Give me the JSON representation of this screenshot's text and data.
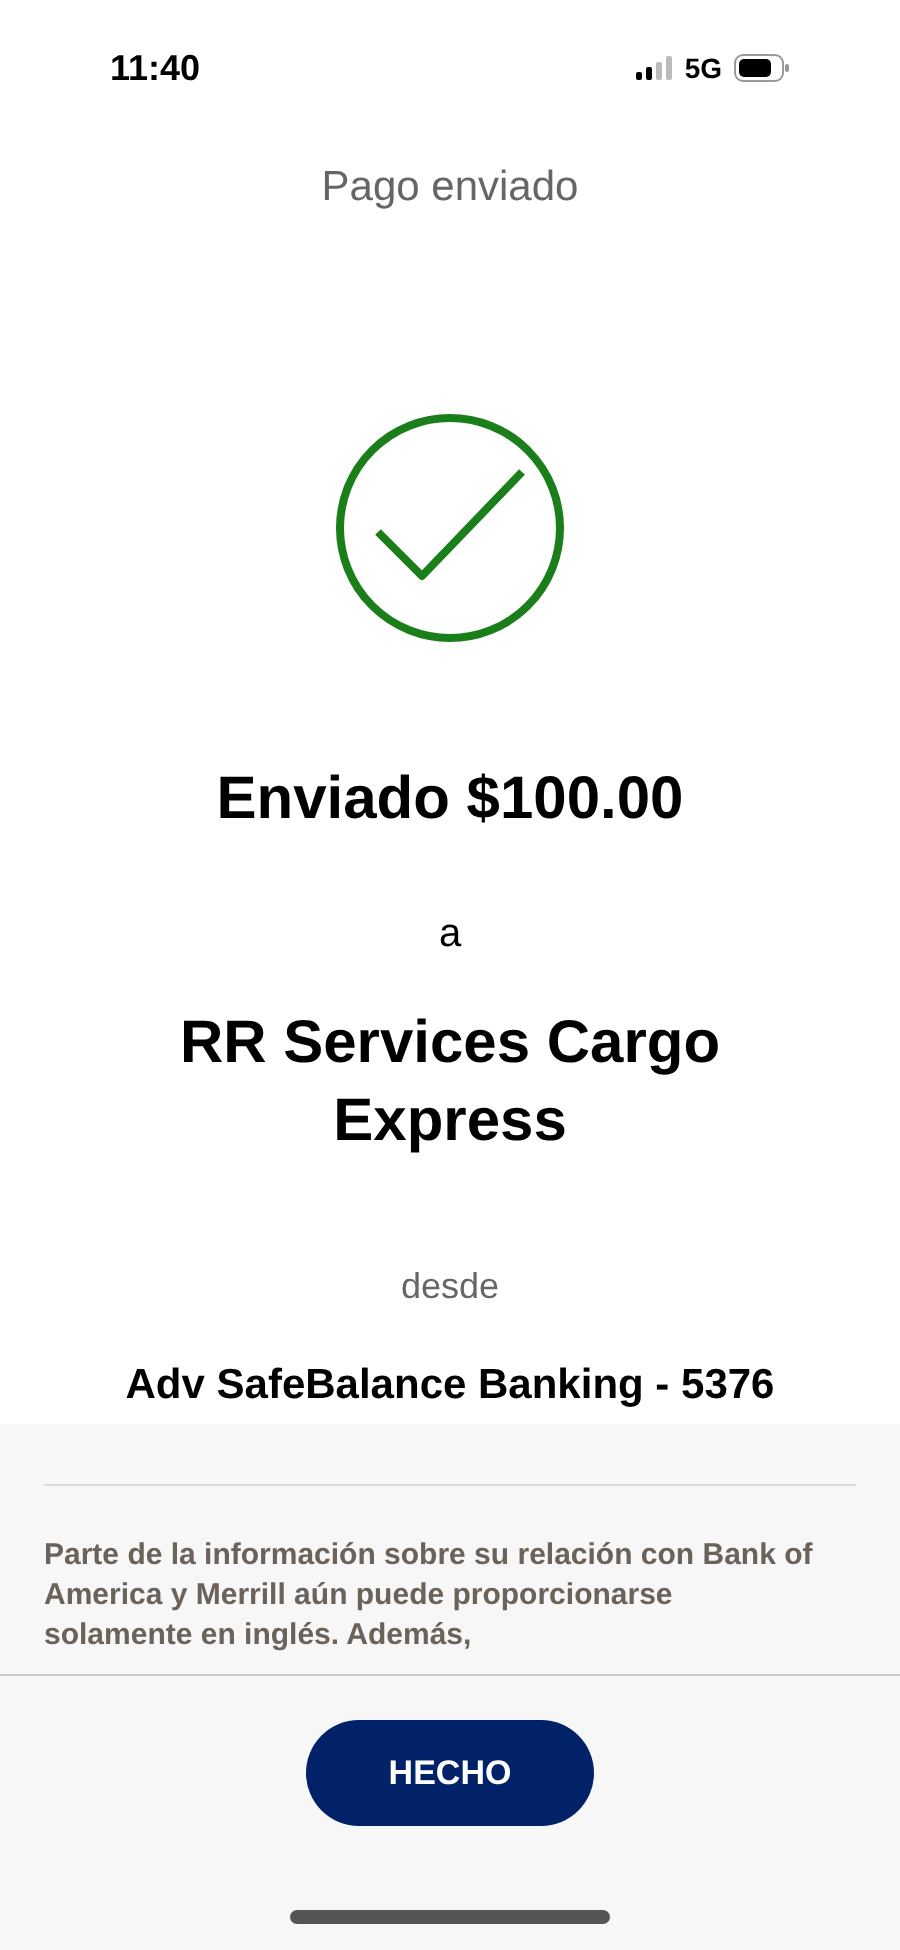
{
  "status_bar": {
    "time": "11:40",
    "network": "5G"
  },
  "title": "Pago enviado",
  "confirmation": {
    "amount_line": "Enviado $100.00",
    "connector": "a",
    "recipient": "RR Services Cargo Express",
    "from_label": "desde",
    "account": "Adv SafeBalance Banking - 5376"
  },
  "disclosure": "Parte de la información sobre su relación con Bank of America y Merrill aún puede proporcionarse solamente en inglés. Además,",
  "buttons": [
    "HECHO"
  ]
}
